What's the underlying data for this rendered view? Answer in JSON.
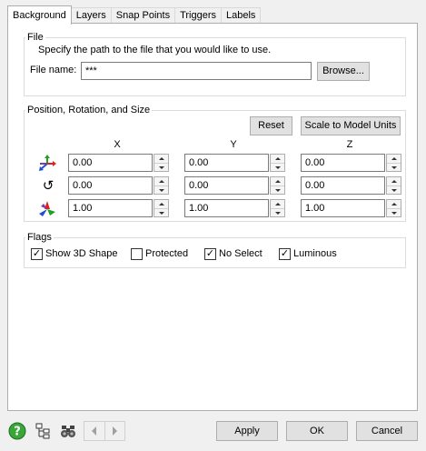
{
  "tabs": [
    {
      "label": "Background",
      "active": true
    },
    {
      "label": "Layers",
      "active": false
    },
    {
      "label": "Snap Points",
      "active": false
    },
    {
      "label": "Triggers",
      "active": false
    },
    {
      "label": "Labels",
      "active": false
    }
  ],
  "file": {
    "legend": "File",
    "description": "Specify the path to the file that you would like to use.",
    "name_label": "File name:",
    "name_value": "***",
    "browse_label": "Browse..."
  },
  "prs": {
    "legend": "Position, Rotation, and Size",
    "reset_label": "Reset",
    "scale_label": "Scale to Model Units",
    "columns": [
      "X",
      "Y",
      "Z"
    ],
    "rows": [
      {
        "icon": "position-axes-icon",
        "values": [
          "0.00",
          "0.00",
          "0.00"
        ]
      },
      {
        "icon": "rotation-icon",
        "values": [
          "0.00",
          "0.00",
          "0.00"
        ]
      },
      {
        "icon": "size-axes-icon",
        "values": [
          "1.00",
          "1.00",
          "1.00"
        ]
      }
    ]
  },
  "flags": {
    "legend": "Flags",
    "items": [
      {
        "label": "Show 3D Shape",
        "checked": true
      },
      {
        "label": "Protected",
        "checked": false
      },
      {
        "label": "No Select",
        "checked": true
      },
      {
        "label": "Luminous",
        "checked": true
      }
    ]
  },
  "footer": {
    "icons": [
      "help-icon",
      "tree-icon",
      "binoculars-icon",
      "back-arrow-icon",
      "forward-arrow-icon"
    ],
    "apply_label": "Apply",
    "ok_label": "OK",
    "cancel_label": "Cancel"
  },
  "colors": {
    "help_green": "#3aa63a",
    "red_axis": "#e02020",
    "green_axis": "#20a020",
    "blue_axis": "#2050d0"
  }
}
